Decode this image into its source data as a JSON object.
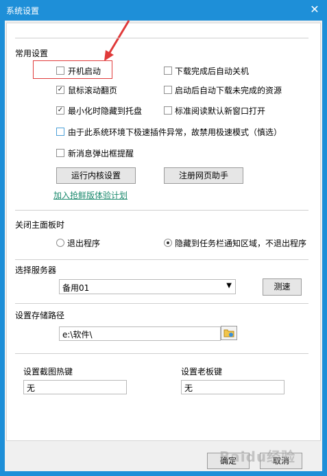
{
  "window": {
    "title": "系统设置",
    "close_glyph": "✕"
  },
  "general": {
    "header": "常用设置",
    "options": [
      {
        "label": "开机启动",
        "checked": false
      },
      {
        "label": "鼠标滚动翻页",
        "checked": true
      },
      {
        "label": "最小化时隐藏到托盘",
        "checked": true
      },
      {
        "label": "由于此系统环境下极速插件异常，故禁用极速模式（慎选）",
        "checked": false
      },
      {
        "label": "新消息弹出框提醒",
        "checked": false
      },
      {
        "label": "下载完成后自动关机",
        "checked": false
      },
      {
        "label": "启动后自动下载未完成的资源",
        "checked": false
      },
      {
        "label": "标准阅读默认新窗口打开",
        "checked": false
      }
    ],
    "kernel_button": "运行内核设置",
    "helper_button": "注册网页助手",
    "trial_link": "加入抢鲜版体验计划"
  },
  "close_panel": {
    "header": "关闭主面板时",
    "exit_option": "退出程序",
    "tray_option": "隐藏到任务栏通知区域，不退出程序",
    "selected": "tray"
  },
  "server": {
    "header": "选择服务器",
    "selected": "备用01",
    "speed_button": "测速"
  },
  "storage": {
    "header": "设置存储路径",
    "path": "e:\\软件\\"
  },
  "hotkeys": {
    "screenshot_label": "设置截图热键",
    "screenshot_value": "无",
    "boss_label": "设置老板键",
    "boss_value": "无"
  },
  "footer": {
    "ok": "确定",
    "cancel": "取消",
    "watermark": "Baidu经验"
  },
  "colors": {
    "titlebar": "#1e8fd8",
    "highlight": "#e03a3a",
    "link": "#1c8a6e"
  }
}
